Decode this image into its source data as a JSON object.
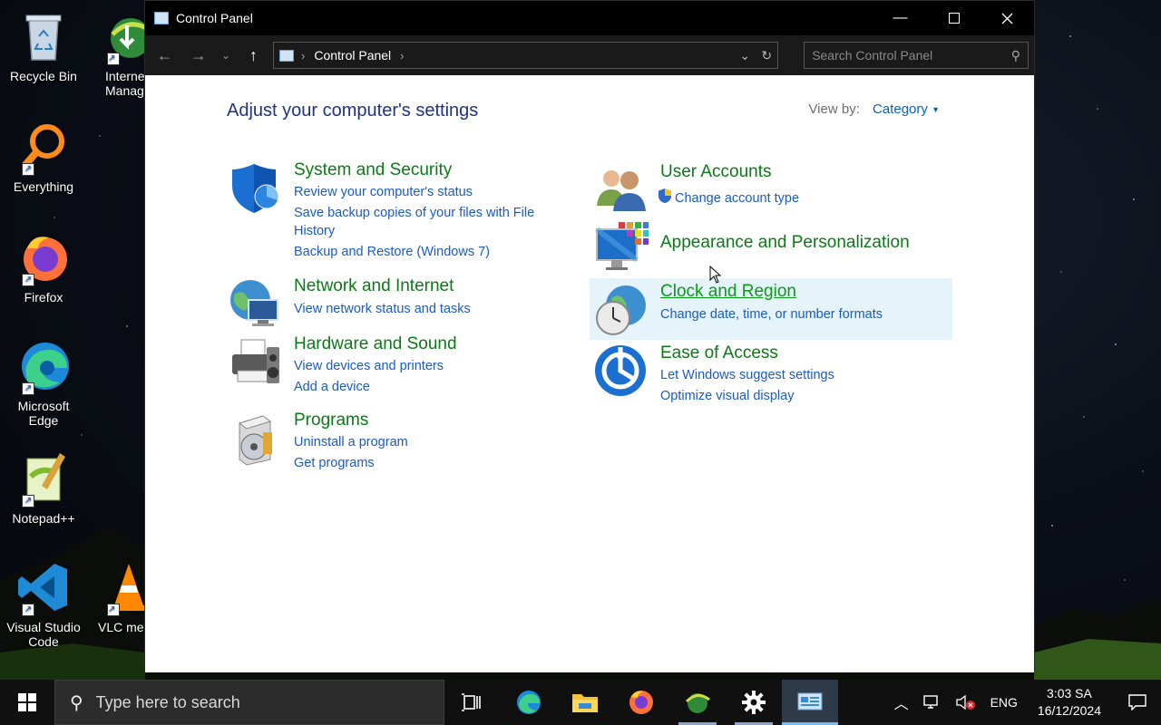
{
  "desktop": {
    "icons": [
      {
        "label": "Recycle Bin"
      },
      {
        "label": "Internet Download Manager"
      },
      {
        "label": "Everything"
      },
      {
        "label": "Firefox"
      },
      {
        "label": "Microsoft Edge"
      },
      {
        "label": "Notepad++"
      },
      {
        "label": "Visual Studio Code"
      },
      {
        "label": "VLC media player"
      }
    ]
  },
  "window": {
    "title": "Control Panel",
    "address": {
      "crumb": "Control Panel"
    },
    "search": {
      "placeholder": "Search Control Panel"
    },
    "heading": "Adjust your computer's settings",
    "view_by": {
      "label": "View by:",
      "value": "Category"
    },
    "categories": [
      {
        "title": "System and Security",
        "icon": "shield-icon",
        "links": [
          "Review your computer's status",
          "Save backup copies of your files with File History",
          "Backup and Restore (Windows 7)"
        ]
      },
      {
        "title": "Network and Internet",
        "icon": "network-globe-icon",
        "links": [
          "View network status and tasks"
        ]
      },
      {
        "title": "Hardware and Sound",
        "icon": "printer-icon",
        "links": [
          "View devices and printers",
          "Add a device"
        ]
      },
      {
        "title": "Programs",
        "icon": "programs-disc-icon",
        "links": [
          "Uninstall a program",
          "Get programs"
        ]
      },
      {
        "title": "User Accounts",
        "icon": "users-icon",
        "links": [
          "Change account type"
        ]
      },
      {
        "title": "Appearance and Personalization",
        "icon": "monitor-palette-icon",
        "links": []
      },
      {
        "title": "Clock and Region",
        "icon": "clock-globe-icon",
        "links": [
          "Change date, time, or number formats"
        ]
      },
      {
        "title": "Ease of Access",
        "icon": "ease-of-access-icon",
        "links": [
          "Let Windows suggest settings",
          "Optimize visual display"
        ]
      }
    ]
  },
  "taskbar": {
    "search_placeholder": "Type here to search",
    "language": "ENG",
    "time": "3:03 SA",
    "date": "16/12/2024"
  },
  "colors": {
    "category_title": "#0b7a16",
    "link": "#1a5bc4",
    "heading": "#1e3287",
    "hover_bg": "#e5f3fb"
  }
}
